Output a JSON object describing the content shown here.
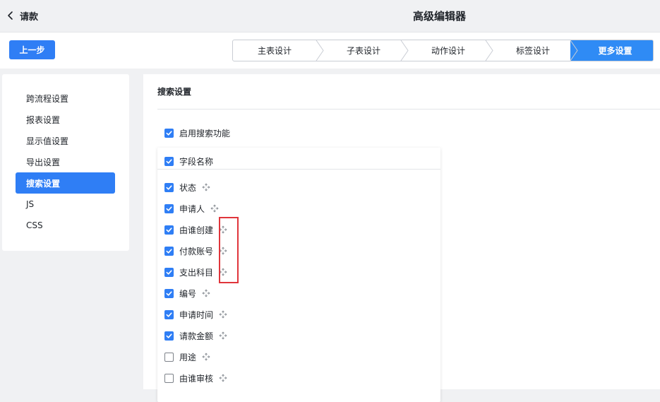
{
  "header": {
    "back_label": "请款",
    "title": "高级编辑器"
  },
  "stepbar": {
    "prev_label": "上一步",
    "steps": [
      {
        "label": "主表设计",
        "active": false
      },
      {
        "label": "子表设计",
        "active": false
      },
      {
        "label": "动作设计",
        "active": false
      },
      {
        "label": "标签设计",
        "active": false
      },
      {
        "label": "更多设置",
        "active": true
      }
    ]
  },
  "sidebar": {
    "items": [
      {
        "label": "跨流程设置",
        "active": false
      },
      {
        "label": "报表设置",
        "active": false
      },
      {
        "label": "显示值设置",
        "active": false
      },
      {
        "label": "导出设置",
        "active": false
      },
      {
        "label": "搜索设置",
        "active": true
      },
      {
        "label": "JS",
        "active": false
      },
      {
        "label": "CSS",
        "active": false
      }
    ]
  },
  "main": {
    "section_title": "搜索设置",
    "enable_search": {
      "label": "启用搜索功能",
      "checked": true
    },
    "fields_header": {
      "label": "字段名称",
      "checked": true
    },
    "fields": [
      {
        "label": "状态",
        "checked": true
      },
      {
        "label": "申请人",
        "checked": true
      },
      {
        "label": "由谁创建",
        "checked": true
      },
      {
        "label": "付款账号",
        "checked": true
      },
      {
        "label": "支出科目",
        "checked": true
      },
      {
        "label": "编号",
        "checked": true
      },
      {
        "label": "申请时间",
        "checked": true
      },
      {
        "label": "请款金额",
        "checked": true
      },
      {
        "label": "用途",
        "checked": false
      },
      {
        "label": "由谁审核",
        "checked": false
      }
    ]
  },
  "colors": {
    "accent": "#2f7ef5",
    "step_active": "#2f8bf5",
    "highlight": "#e0353b",
    "background": "#f0f1f3"
  },
  "icons": {
    "back": "chevron-left-icon",
    "drag": "move-icon",
    "checkbox": "checkbox-icon"
  }
}
